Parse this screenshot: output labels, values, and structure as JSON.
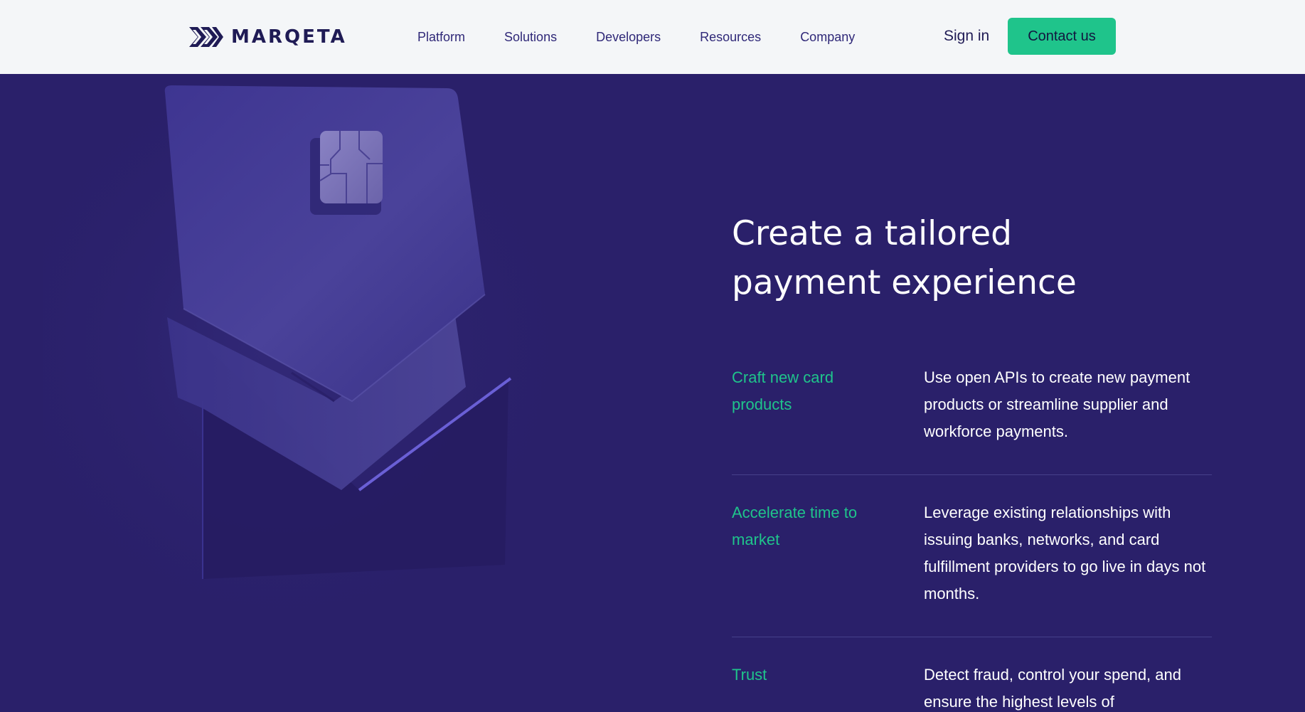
{
  "brand": {
    "name": "MARQETA",
    "logo_icon": "chevrons-logo-icon"
  },
  "nav": {
    "items": [
      {
        "label": "Platform"
      },
      {
        "label": "Solutions"
      },
      {
        "label": "Developers"
      },
      {
        "label": "Resources"
      },
      {
        "label": "Company"
      }
    ],
    "sign_in": "Sign in",
    "contact": "Contact us"
  },
  "hero": {
    "headline": "Create a tailored payment experience",
    "features": [
      {
        "title": "Craft new card products",
        "description": "Use open APIs to create new payment products or streamline supplier and workforce payments."
      },
      {
        "title": "Accelerate time to market",
        "description": "Leverage existing relationships with issuing banks, networks, and card fulfillment providers to go live in days not months."
      },
      {
        "title": "Trust",
        "description": "Detect fraud, control your spend, and ensure the highest levels of"
      }
    ]
  },
  "colors": {
    "header_bg": "#f4f6f8",
    "hero_bg": "#2a206a",
    "accent_green": "#1fc48b",
    "nav_text": "#2f2878",
    "brand_dark": "#1f1b55"
  }
}
